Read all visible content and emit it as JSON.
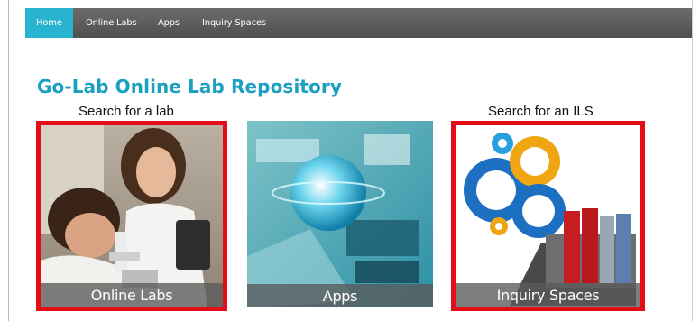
{
  "nav": {
    "items": [
      {
        "label": "Home",
        "active": true
      },
      {
        "label": "Online Labs",
        "active": false
      },
      {
        "label": "Apps",
        "active": false
      },
      {
        "label": "Inquiry Spaces",
        "active": false
      }
    ]
  },
  "page": {
    "title": "Go-Lab Online Lab Repository",
    "caption_lab": "Search for a lab",
    "caption_ils": "Search for an ILS"
  },
  "tiles": [
    {
      "label": "Online Labs",
      "image": "scientists-microscope-photo",
      "highlighted": true
    },
    {
      "label": "Apps",
      "image": "digital-globe-data-photo",
      "highlighted": false
    },
    {
      "label": "Inquiry Spaces",
      "image": "gears-laptop-folders-photo",
      "highlighted": true
    }
  ],
  "colors": {
    "accent": "#28b3cf",
    "title": "#1ba0c2",
    "highlight_border": "#e20d17",
    "navbar": "#5a5a5a"
  }
}
